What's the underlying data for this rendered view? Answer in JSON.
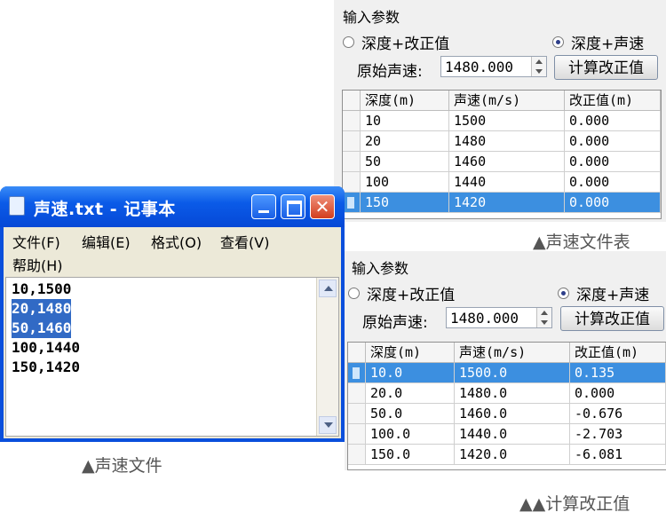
{
  "top_panel": {
    "group_title": "输入参数",
    "radio_left": "深度+改正值",
    "radio_right": "深度+声速",
    "speed_label": "原始声速:",
    "speed_value": "1480.000",
    "compute_button": "计算改正值",
    "columns": [
      "深度(m)",
      "声速(m/s)",
      "改正值(m)"
    ],
    "rows": [
      [
        "10",
        "1500",
        "0.000"
      ],
      [
        "20",
        "1480",
        "0.000"
      ],
      [
        "50",
        "1460",
        "0.000"
      ],
      [
        "100",
        "1440",
        "0.000"
      ],
      [
        "150",
        "1420",
        "0.000"
      ]
    ],
    "caption": "▲声速文件表"
  },
  "bottom_panel": {
    "group_title": "输入参数",
    "radio_left": "深度+改正值",
    "radio_right": "深度+声速",
    "speed_label": "原始声速:",
    "speed_value": "1480.000",
    "compute_button": "计算改正值",
    "columns": [
      "深度(m)",
      "声速(m/s)",
      "改正值(m)"
    ],
    "rows": [
      [
        "10.0",
        "1500.0",
        "0.135"
      ],
      [
        "20.0",
        "1480.0",
        "0.000"
      ],
      [
        "50.0",
        "1460.0",
        "-0.676"
      ],
      [
        "100.0",
        "1440.0",
        "-2.703"
      ],
      [
        "150.0",
        "1420.0",
        "-6.081"
      ]
    ],
    "caption": "▲▲计算改正值"
  },
  "notepad": {
    "title": "声速.txt - 记事本",
    "menu": [
      "文件(F)",
      "编辑(E)",
      "格式(O)",
      "查看(V)",
      "帮助(H)"
    ],
    "lines": [
      "10,1500",
      "20,1480",
      "50,1460",
      "100,1440",
      "150,1420"
    ],
    "caption": "▲声速文件"
  },
  "colors": {
    "selection": "#3c8fe0",
    "xp_title": "#0b5be8",
    "xp_close": "#d23e1e"
  }
}
